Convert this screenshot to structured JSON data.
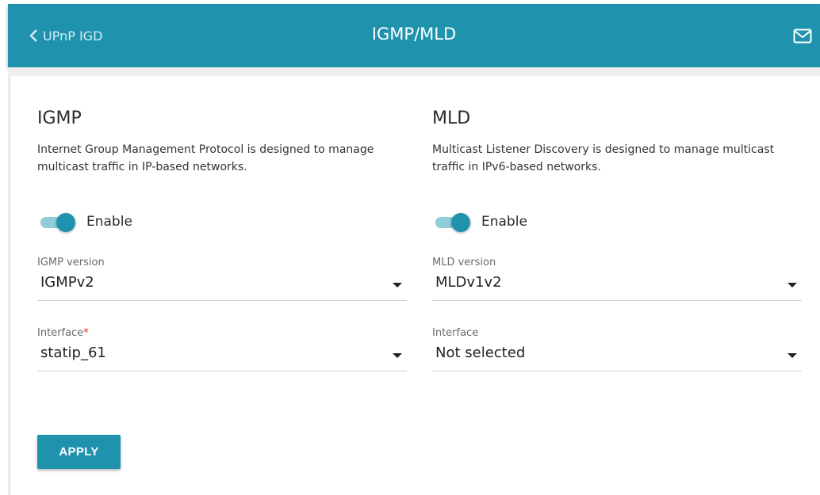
{
  "header": {
    "back_label": "UPnP IGD",
    "title": "IGMP/MLD",
    "icons": {
      "back": "chevron-left-icon",
      "mail": "mail-icon"
    }
  },
  "igmp": {
    "title": "IGMP",
    "description": "Internet Group Management Protocol is designed to manage multicast traffic in IP-based networks.",
    "enable_label": "Enable",
    "enabled": true,
    "version_label": "IGMP version",
    "version_value": "IGMPv2",
    "interface_label": "Interface",
    "interface_required_mark": "*",
    "interface_value": "statip_61"
  },
  "mld": {
    "title": "MLD",
    "description": "Multicast Listener Discovery is designed to manage multicast traffic in IPv6-based networks.",
    "enable_label": "Enable",
    "enabled": true,
    "version_label": "MLD version",
    "version_value": "MLDv1v2",
    "interface_label": "Interface",
    "interface_value": "Not selected"
  },
  "apply_label": "APPLY",
  "colors": {
    "accent": "#1f93ad",
    "toggle_track": "#8ecddc",
    "required": "#e0301e"
  }
}
